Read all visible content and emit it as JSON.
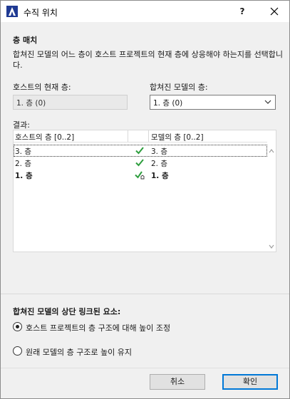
{
  "window": {
    "title": "수직 위치",
    "help_label": "?",
    "close_label": "✕",
    "icon": "archicad-app-icon"
  },
  "floor_match": {
    "section_title": "층 매치",
    "description": "합쳐진 모델의 어느 층이 호스트 프로젝트의 현재 층에 상응해야 하는지를 선택합니다.",
    "host_label": "호스트의 현재 층:",
    "host_value": "1. 층 (0)",
    "merged_label": "합쳐진 모델의 층:",
    "merged_value": "1. 층 (0)"
  },
  "results": {
    "label": "결과:",
    "columns": [
      "호스트의 층 [0..2]",
      "",
      "모델의 층 [0..2]"
    ],
    "rows": [
      {
        "host": "3. 층",
        "status_icon": "green-check-icon",
        "model": "3. 층",
        "selected": true,
        "bold": false
      },
      {
        "host": "2. 층",
        "status_icon": "green-check-icon",
        "model": "2. 층",
        "selected": false,
        "bold": false
      },
      {
        "host": "1. 층",
        "status_icon": "green-check-home-icon",
        "model": "1. 층",
        "selected": false,
        "bold": true
      }
    ]
  },
  "top_linked": {
    "section_title": "합쳐진 모델의 상단 링크된 요소:",
    "options": [
      {
        "label": "호스트 프로젝트의 층 구조에 대해 높이 조정",
        "checked": true
      },
      {
        "label": "원래 모델의 층 구조로 높이 유지",
        "checked": false
      }
    ]
  },
  "buttons": {
    "cancel": "취소",
    "ok": "확인"
  },
  "colors": {
    "check_green": "#2e9e3e",
    "primary_border": "#0078d7"
  }
}
